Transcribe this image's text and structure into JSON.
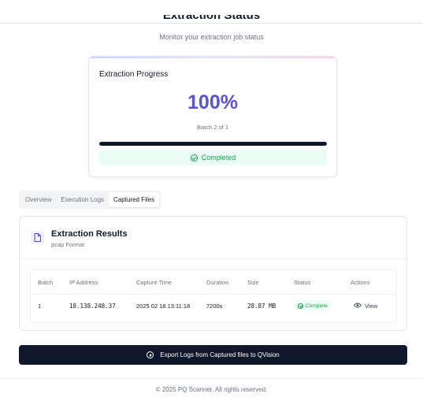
{
  "header": {
    "title": "Extraction Status",
    "subtitle": "Monitor your extraction job status"
  },
  "progress": {
    "card_title": "Extraction Progress",
    "percent_label": "100%",
    "percent_value": 1.0,
    "batch_text": "Batch 2 of 1",
    "status": "Completed",
    "accent_color": "#5b52d6",
    "success_color": "#16a34a"
  },
  "tabs": [
    {
      "label": "Overview"
    },
    {
      "label": "Execution Logs"
    },
    {
      "label": "Captured Files"
    }
  ],
  "active_tab": "Captured Files",
  "results": {
    "title": "Extraction Results",
    "subtitle": "pcap Format",
    "columns": [
      "Batch",
      "IP Address",
      "Capture Time",
      "Duration",
      "Size",
      "Status",
      "Actions"
    ],
    "rows": [
      {
        "batch": "1",
        "ip": "18.138.248.37",
        "capture_time": "2025 02 18 13:11:18",
        "duration": "7200s",
        "size": "28.87 MB",
        "status": "Complete",
        "action": "View"
      }
    ]
  },
  "export_button": {
    "label": "Export Logs from Captured files to QVision"
  },
  "footer": {
    "text": "© 2025 PQ Scanner. All rights reserved."
  },
  "icons": [
    "check-circle-icon",
    "file-icon",
    "eye-icon",
    "play-circle-icon"
  ]
}
